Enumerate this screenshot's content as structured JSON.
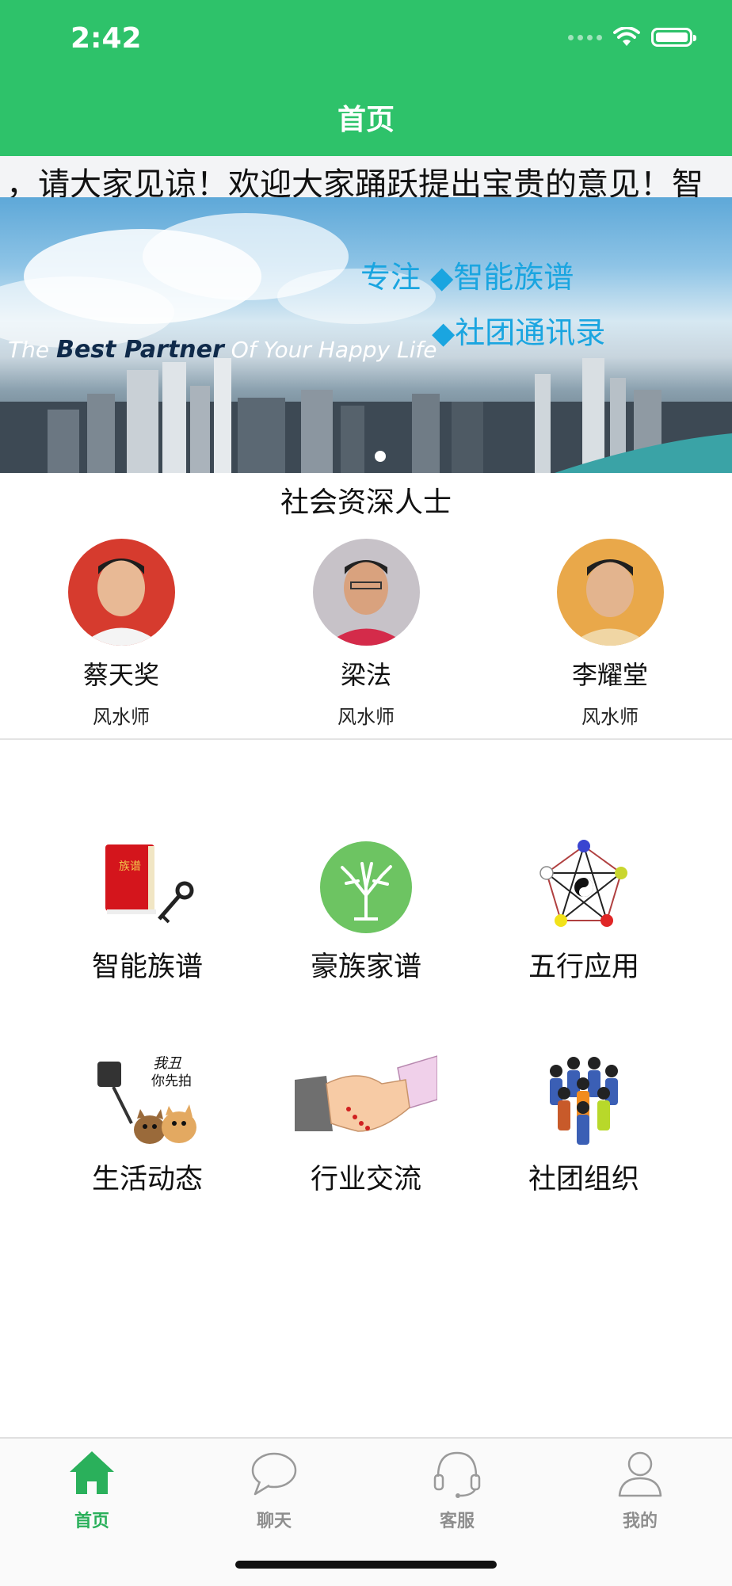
{
  "status_bar": {
    "time": "2:42"
  },
  "nav": {
    "title": "首页"
  },
  "marquee": {
    "text": "，请大家见谅！欢迎大家踊跃提出宝贵的意见！智"
  },
  "banner": {
    "line1": "专注 ◆智能族谱",
    "line2": "◆社团通讯录",
    "tagline_prefix": "The ",
    "tagline_strong": "Best Partner",
    "tagline_suffix": " Of Your Happy Life"
  },
  "experts": {
    "title": "社会资深人士",
    "items": [
      {
        "name": "蔡天奖",
        "title": "风水师"
      },
      {
        "name": "梁法",
        "title": "风水师"
      },
      {
        "name": "李耀堂",
        "title": "风水师"
      }
    ]
  },
  "features": [
    {
      "label": "智能族谱",
      "book_text": "族谱"
    },
    {
      "label": "豪族家谱"
    },
    {
      "label": "五行应用"
    },
    {
      "label": "生活动态",
      "caption1": "我丑",
      "caption2": "你先拍"
    },
    {
      "label": "行业交流"
    },
    {
      "label": "社团组织"
    }
  ],
  "tabbar": {
    "tabs": [
      {
        "label": "首页",
        "icon": "home-icon",
        "active": true
      },
      {
        "label": "聊天",
        "icon": "chat-bubble-icon",
        "active": false
      },
      {
        "label": "客服",
        "icon": "headset-icon",
        "active": false
      },
      {
        "label": "我的",
        "icon": "user-icon",
        "active": false
      }
    ]
  },
  "colors": {
    "primary": "#2ec26a",
    "tab_active": "#2ab05b",
    "tab_inactive": "#8e8e8e",
    "banner_text": "#1aa5e0"
  }
}
